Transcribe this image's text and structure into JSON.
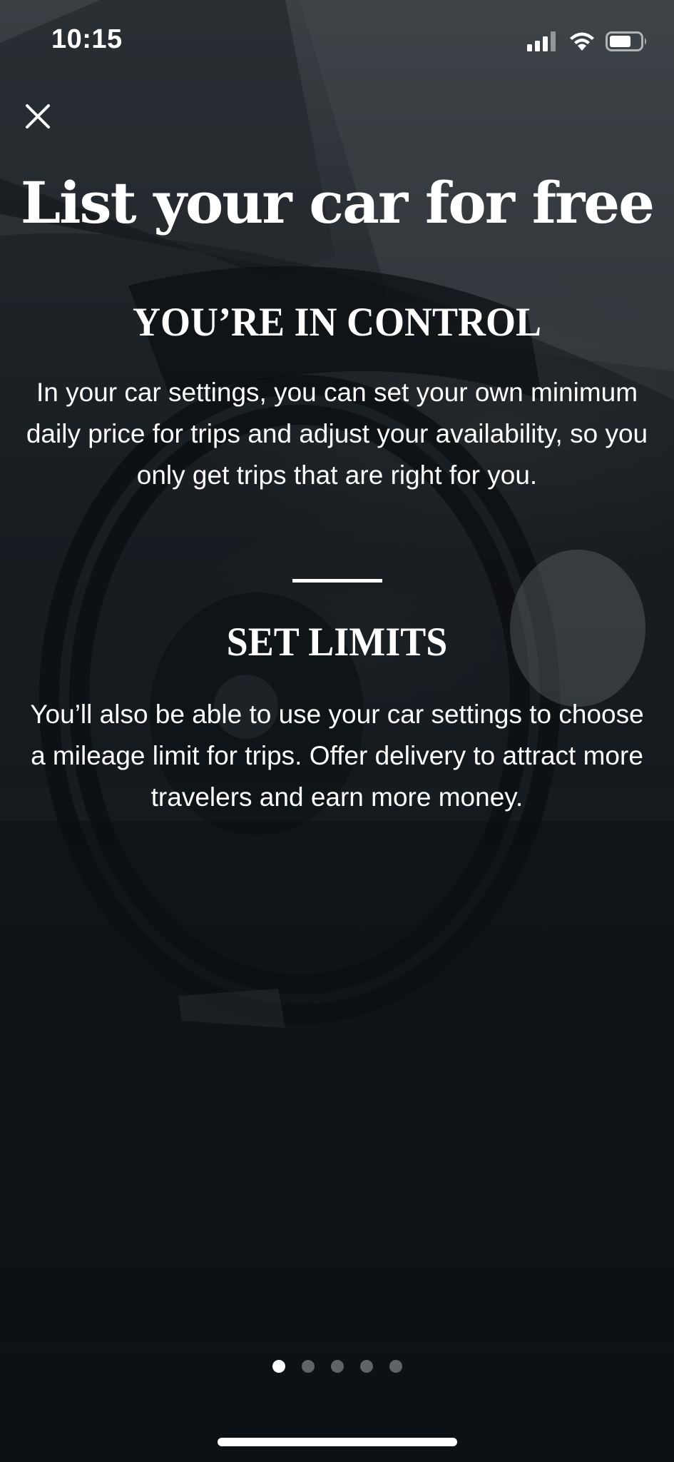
{
  "status_bar": {
    "time": "10:15",
    "icons": [
      "cellular-signal-icon",
      "wifi-icon",
      "battery-icon"
    ]
  },
  "close_button": {
    "icon": "close-icon"
  },
  "title": "List your car for free",
  "sections": [
    {
      "heading": "YOU’RE IN CONTROL",
      "body": "In your car settings, you can set your own minimum daily price for trips and adjust your availability, so you only get trips that are right for you."
    },
    {
      "heading": "SET LIMITS",
      "body": "You’ll also be able to use your car settings to choose a mileage limit for trips. Offer delivery to attract more travelers and earn more money."
    }
  ],
  "pager": {
    "total": 5,
    "active_index": 0
  },
  "colors": {
    "text": "#ffffff",
    "background": "#1a2026",
    "dot_inactive": "rgba(255,255,255,0.35)"
  }
}
